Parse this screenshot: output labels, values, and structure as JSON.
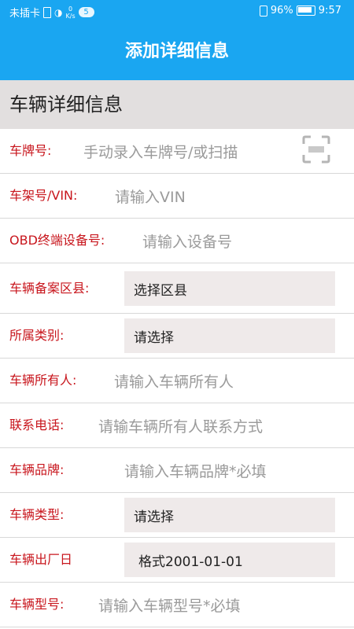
{
  "status_bar": {
    "carrier": "未插卡",
    "net_speed_value": "0",
    "net_speed_unit": "K/s",
    "notification_count": "5",
    "battery": "96%",
    "time": "9:57"
  },
  "header": {
    "title": "添加详细信息"
  },
  "section": {
    "title": "车辆详细信息"
  },
  "form": {
    "plate": {
      "label": "车牌号:",
      "placeholder": "手动录入车牌号/或扫描"
    },
    "vin": {
      "label": "车架号/VIN:",
      "placeholder": "请输入VIN"
    },
    "obd": {
      "label": "OBD终端设备号:",
      "placeholder": "请输入设备号"
    },
    "district": {
      "label": "车辆备案区县:",
      "value": "选择区县"
    },
    "category": {
      "label": "所属类别:",
      "value": "请选择"
    },
    "owner": {
      "label": "车辆所有人:",
      "placeholder": "请输入车辆所有人"
    },
    "phone": {
      "label": "联系电话:",
      "placeholder": "请输车辆所有人联系方式"
    },
    "brand": {
      "label": "车辆品牌:",
      "placeholder": "请输入车辆品牌*必填"
    },
    "type": {
      "label": "车辆类型:",
      "value": "请选择"
    },
    "mfg_date": {
      "label": "车辆出厂日",
      "value": "格式2001-01-01"
    },
    "model": {
      "label": "车辆型号:",
      "placeholder": "请输入车辆型号*必填"
    }
  }
}
